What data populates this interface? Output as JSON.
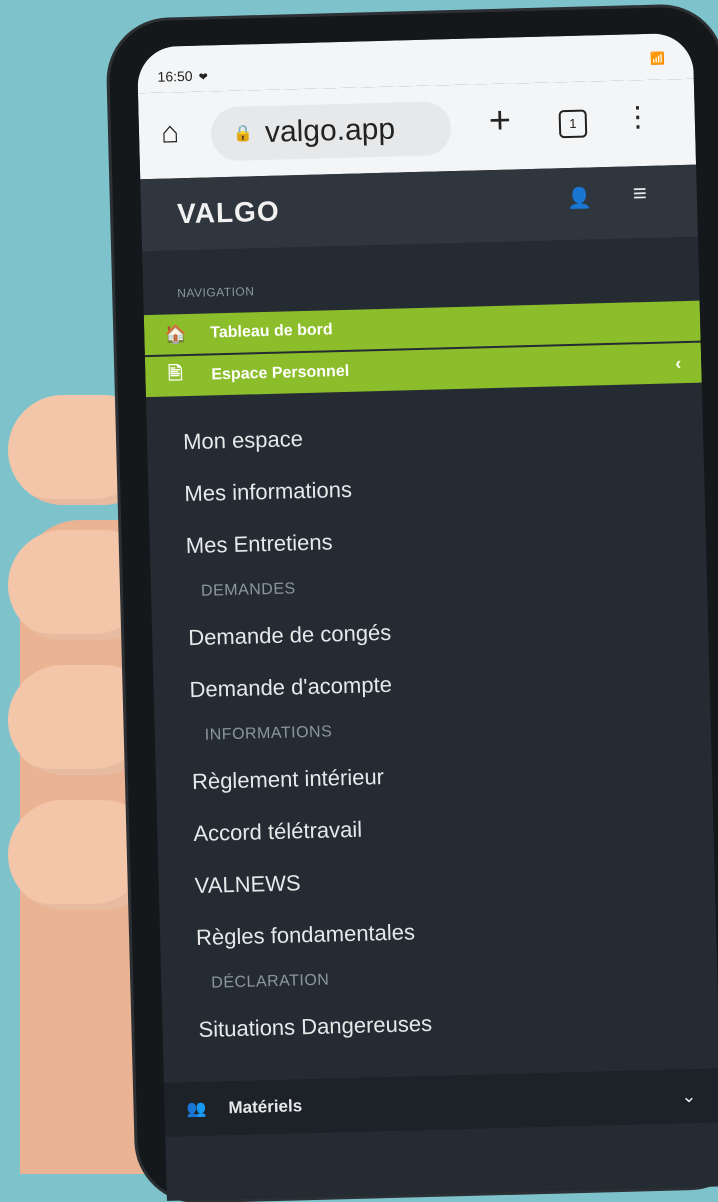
{
  "status_bar": {
    "time": "16:50",
    "heart": "❤",
    "network": "📶"
  },
  "browser": {
    "home_icon": "⌂",
    "lock_icon": "🔒",
    "url": "valgo.app",
    "new_tab": "+",
    "tab_count": "1",
    "menu": "⋮"
  },
  "app": {
    "logo": "VALGO",
    "user_icon": "👤",
    "menu_icon": "≡"
  },
  "nav": {
    "section_label": "NAVIGATION",
    "dashboard": "Tableau de bord",
    "dashboard_icon": "🏠",
    "personal_space": "Espace Personnel",
    "personal_space_icon": "🖹",
    "personal_space_chevron": "‹",
    "items_a": [
      "Mon espace",
      "Mes informations",
      "Mes Entretiens"
    ],
    "section_demandes": "DEMANDES",
    "items_b": [
      "Demande de congés",
      "Demande d'acompte"
    ],
    "section_informations": "INFORMATIONS",
    "items_c": [
      "Règlement intérieur",
      "Accord télétravail",
      "VALNEWS",
      "Règles fondamentales"
    ],
    "section_declaration": "DÉCLARATION",
    "items_d": [
      "Situations Dangereuses"
    ],
    "bottom_label": "Matériels",
    "bottom_icon": "👥",
    "bottom_chevron": "⌄"
  },
  "colors": {
    "accent": "#8cbd2a",
    "sidebar": "#242b32",
    "background": "#7ec3cc"
  }
}
